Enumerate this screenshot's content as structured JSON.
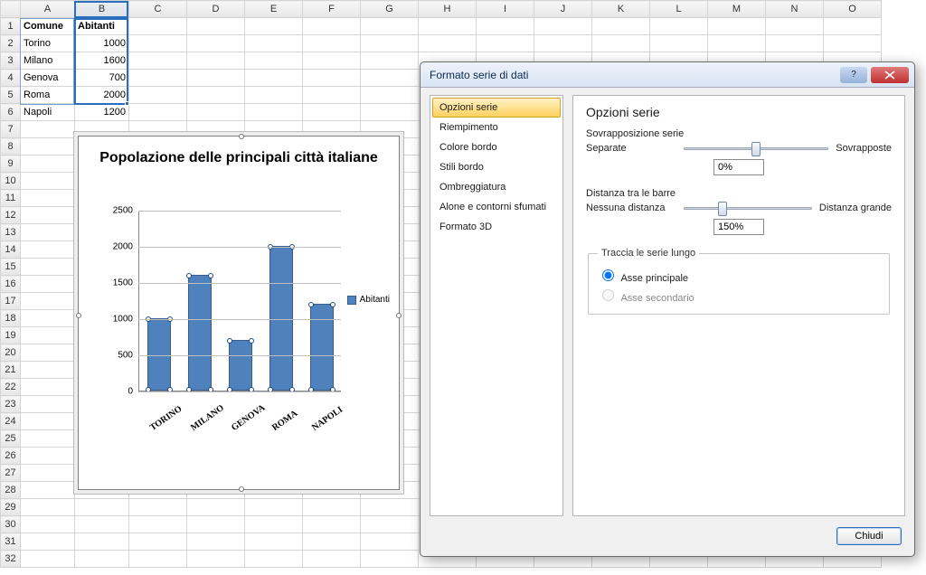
{
  "columns": [
    "A",
    "B",
    "C",
    "D",
    "E",
    "F",
    "G",
    "H",
    "I",
    "J",
    "K",
    "L",
    "M",
    "N",
    "O"
  ],
  "row_count": 32,
  "headers": {
    "col0": "Comune",
    "col1": "Abitanti"
  },
  "rows": [
    {
      "city": "Torino",
      "pop": "1000"
    },
    {
      "city": "Milano",
      "pop": "1600"
    },
    {
      "city": "Genova",
      "pop": "700"
    },
    {
      "city": "Roma",
      "pop": "2000"
    },
    {
      "city": "Napoli",
      "pop": "1200"
    }
  ],
  "chart_data": {
    "type": "bar",
    "title": "Popolazione delle principali città italiane",
    "categories": [
      "TORINO",
      "MILANO",
      "GENOVA",
      "ROMA",
      "NAPOLI"
    ],
    "values": [
      1000,
      1600,
      700,
      2000,
      1200
    ],
    "series_name": "Abitanti",
    "ylim": [
      0,
      2500
    ],
    "ytick": 500,
    "yticks": [
      "0",
      "500",
      "1000",
      "1500",
      "2000",
      "2500"
    ],
    "legend_position": "right",
    "xlabel": "",
    "ylabel": ""
  },
  "dialog": {
    "title": "Formato serie di dati",
    "nav": [
      "Opzioni serie",
      "Riempimento",
      "Colore bordo",
      "Stili bordo",
      "Ombreggiatura",
      "Alone e contorni sfumati",
      "Formato 3D"
    ],
    "nav_selected": 0,
    "section_title": "Opzioni serie",
    "overlap": {
      "group_label": "Sovrapposizione serie",
      "left": "Separate",
      "right": "Sovrapposte",
      "value": "0%",
      "percent": 50
    },
    "gap": {
      "group_label": "Distanza tra le barre",
      "left": "Nessuna distanza",
      "right": "Distanza grande",
      "value": "150%",
      "percent": 30
    },
    "axis": {
      "legend": "Traccia le serie lungo",
      "primary": "Asse principale",
      "secondary": "Asse secondario",
      "selected": "primary"
    },
    "close_label": "Chiudi"
  }
}
